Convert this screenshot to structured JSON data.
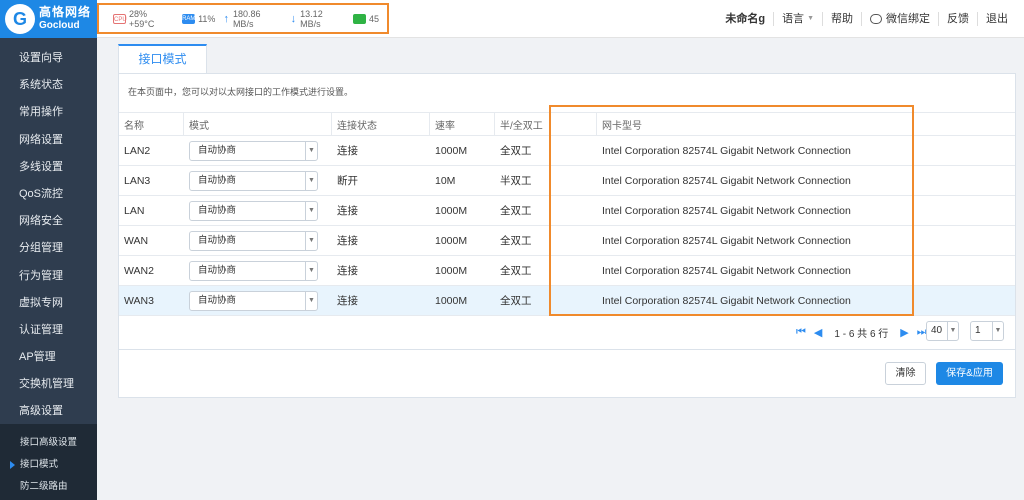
{
  "brand": {
    "logo_glyph": "G",
    "name_cn": "高恪网络",
    "name_en": "Gocloud"
  },
  "status": {
    "cpu_icon": "CPU",
    "cpu": "28% +59°C",
    "ram_icon": "RAM",
    "ram": "11%",
    "upload": "180.86 MB/s",
    "download": "13.12 MB/s",
    "online": "45"
  },
  "topnav": {
    "device": "未命名g",
    "language": "语言",
    "help": "帮助",
    "wechat": "微信绑定",
    "feedback": "反馈",
    "logout": "退出"
  },
  "sidebar": {
    "items": [
      "设置向导",
      "系统状态",
      "常用操作",
      "网络设置",
      "多线设置",
      "QoS流控",
      "网络安全",
      "分组管理",
      "行为管理",
      "虚拟专网",
      "认证管理",
      "AP管理",
      "交换机管理",
      "高级设置"
    ],
    "sub_items": [
      "接口高级设置",
      "接口模式",
      "防二级路由"
    ]
  },
  "tab": {
    "label": "接口模式"
  },
  "description": "在本页面中，您可以对以太网接口的工作模式进行设置。",
  "table": {
    "headers": {
      "name": "名称",
      "mode": "模式",
      "link": "连接状态",
      "speed": "速率",
      "duplex": "半/全双工",
      "nic": "网卡型号"
    },
    "rows": [
      {
        "name": "LAN2",
        "mode": "自动协商",
        "link": "连接",
        "speed": "1000M",
        "duplex": "全双工",
        "nic": "Intel Corporation 82574L Gigabit Network Connection"
      },
      {
        "name": "LAN3",
        "mode": "自动协商",
        "link": "断开",
        "speed": "10M",
        "duplex": "半双工",
        "nic": "Intel Corporation 82574L Gigabit Network Connection"
      },
      {
        "name": "LAN",
        "mode": "自动协商",
        "link": "连接",
        "speed": "1000M",
        "duplex": "全双工",
        "nic": "Intel Corporation 82574L Gigabit Network Connection"
      },
      {
        "name": "WAN",
        "mode": "自动协商",
        "link": "连接",
        "speed": "1000M",
        "duplex": "全双工",
        "nic": "Intel Corporation 82574L Gigabit Network Connection"
      },
      {
        "name": "WAN2",
        "mode": "自动协商",
        "link": "连接",
        "speed": "1000M",
        "duplex": "全双工",
        "nic": "Intel Corporation 82574L Gigabit Network Connection"
      },
      {
        "name": "WAN3",
        "mode": "自动协商",
        "link": "连接",
        "speed": "1000M",
        "duplex": "全双工",
        "nic": "Intel Corporation 82574L Gigabit Network Connection"
      }
    ]
  },
  "pagination": {
    "summary": "1 - 6 共 6 行",
    "page_size": "40",
    "page": "1"
  },
  "buttons": {
    "clear": "清除",
    "save": "保存&应用"
  },
  "colors": {
    "accent": "#2d8cf0",
    "sidebar_bg": "#2f3d4f",
    "highlight_border": "#f08a2c"
  }
}
